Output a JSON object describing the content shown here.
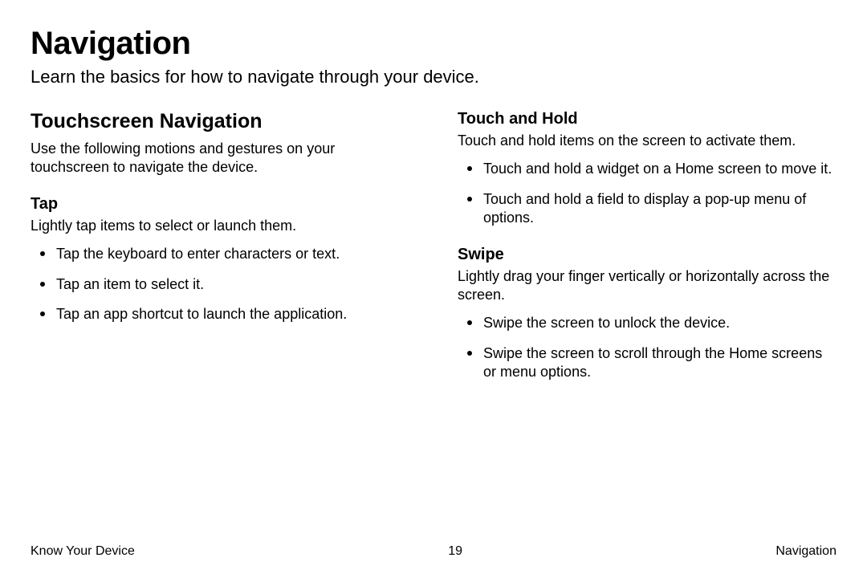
{
  "header": {
    "title": "Navigation",
    "subtitle": "Learn the basics for how to navigate through your device."
  },
  "left": {
    "section_heading": "Touchscreen Navigation",
    "section_intro": "Use the following motions and gestures on your touchscreen to navigate the device.",
    "tap_heading": "Tap",
    "tap_desc": "Lightly tap items to select or launch them.",
    "tap_items": [
      "Tap the keyboard to enter characters or text.",
      "Tap an item to select it.",
      "Tap an app shortcut to launch the application."
    ]
  },
  "right": {
    "touchhold_heading": "Touch and Hold",
    "touchhold_desc": "Touch and hold items on the screen to activate them.",
    "touchhold_items": [
      "Touch and hold a widget on a Home screen to move it.",
      "Touch and hold a field to display a pop-up menu of options."
    ],
    "swipe_heading": "Swipe",
    "swipe_desc": "Lightly drag your finger vertically or horizontally across the screen.",
    "swipe_items": [
      "Swipe the screen to unlock the device.",
      "Swipe the screen to scroll through the Home screens or menu options."
    ]
  },
  "footer": {
    "left": "Know Your Device",
    "center": "19",
    "right": "Navigation"
  }
}
